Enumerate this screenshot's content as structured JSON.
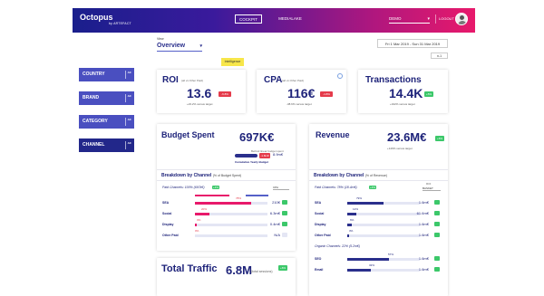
{
  "header": {
    "logo": "Octopus",
    "logo_sub": "by ARTEFACT",
    "tabs": [
      {
        "label": "COCKPIT"
      },
      {
        "label": "MEDIALAKE"
      }
    ],
    "account": "DEMO",
    "logout": "LOGOUT"
  },
  "controls": {
    "view_label": "View",
    "view_value": "Overview",
    "date_range": "Fri 1 Mar 2019 - Sun 31 Mar 2019",
    "comparison": "n-1",
    "intelligence": "Intelligence"
  },
  "filters": [
    {
      "label": "COUNTRY",
      "badge": "All"
    },
    {
      "label": "BRAND",
      "badge": "All"
    },
    {
      "label": "CATEGORY",
      "badge": "All"
    },
    {
      "label": "CHANNEL",
      "badge": "All"
    }
  ],
  "kpis": {
    "roi": {
      "title": "ROI",
      "sub": "(all vs Other Paid)",
      "value": "13.6",
      "delta": "-6.8%",
      "target": "+23.2% versus target"
    },
    "cpa": {
      "title": "CPA",
      "sub": "(all vs Other Paid)",
      "value": "116€",
      "delta": "-4.8%",
      "target": "-38.6% versus target"
    },
    "transactions": {
      "title": "Transactions",
      "value": "14.4K",
      "delta": "+5%",
      "target": "+342% versus target"
    }
  },
  "budget": {
    "title": "Budget Spent",
    "value": "697K€",
    "behind_label": "Behind linear budget spent",
    "cumulative_label": "Cumulative Yearly Budget",
    "tag": "-1.8m€",
    "tag2": "8.9m€",
    "breakdown_title": "Breakdown by Channel",
    "breakdown_sub": "(% of Budget Spent)",
    "group_label": "Paid Channels: 100% (697k€)",
    "group_tag": "+4%",
    "select": "CPA",
    "rows": [
      {
        "label": "SEA",
        "pct": "78%",
        "fill": 0.78,
        "value": "210€",
        "color": "#e8196b"
      },
      {
        "label": "Social",
        "pct": "20%",
        "fill": 0.2,
        "value": "6.3m€",
        "color": "#e8196b"
      },
      {
        "label": "Display",
        "pct": "3%",
        "fill": 0.03,
        "value": "0.4m€",
        "color": "#e8196b"
      },
      {
        "label": "Other Paid",
        "pct": "0%",
        "fill": 0.0,
        "value": "N/A",
        "color": "#e8196b"
      }
    ]
  },
  "revenue": {
    "title": "Revenue",
    "value": "23.6M€",
    "delta": "+6%",
    "target": "+149% versus target",
    "breakdown_title": "Breakdown by Channel",
    "breakdown_sub": "(% of Revenue)",
    "group_label": "Paid Channels: 78% (18.4m€)",
    "group_tag": "+4%",
    "select_label": "ROI",
    "select_value": "BASKET",
    "rows": [
      {
        "label": "SEA",
        "pct": "79%",
        "fill": 0.5,
        "value": "1.6m€",
        "color": "#2a2f8c"
      },
      {
        "label": "Social",
        "pct": "12%",
        "fill": 0.12,
        "value": "61.6m€",
        "color": "#2a2f8c"
      },
      {
        "label": "Display",
        "pct": "6%",
        "fill": 0.06,
        "value": "1.6m€",
        "color": "#2a2f8c"
      },
      {
        "label": "Other Paid",
        "pct": "3%",
        "fill": 0.03,
        "value": "1.6m€",
        "color": "#2a2f8c"
      }
    ],
    "group2_label": "Organic Channels: 22% (5.2m€)",
    "rows2": [
      {
        "label": "SEO",
        "pct": "57%",
        "fill": 0.57,
        "value": "1.6m€",
        "color": "#2a2f8c"
      },
      {
        "label": "Email",
        "pct": "32%",
        "fill": 0.32,
        "value": "1.6m€",
        "color": "#2a2f8c"
      }
    ]
  },
  "traffic": {
    "title": "Total Traffic",
    "value": "6.8M",
    "sub": "(total sessions)",
    "delta": "+6%"
  }
}
